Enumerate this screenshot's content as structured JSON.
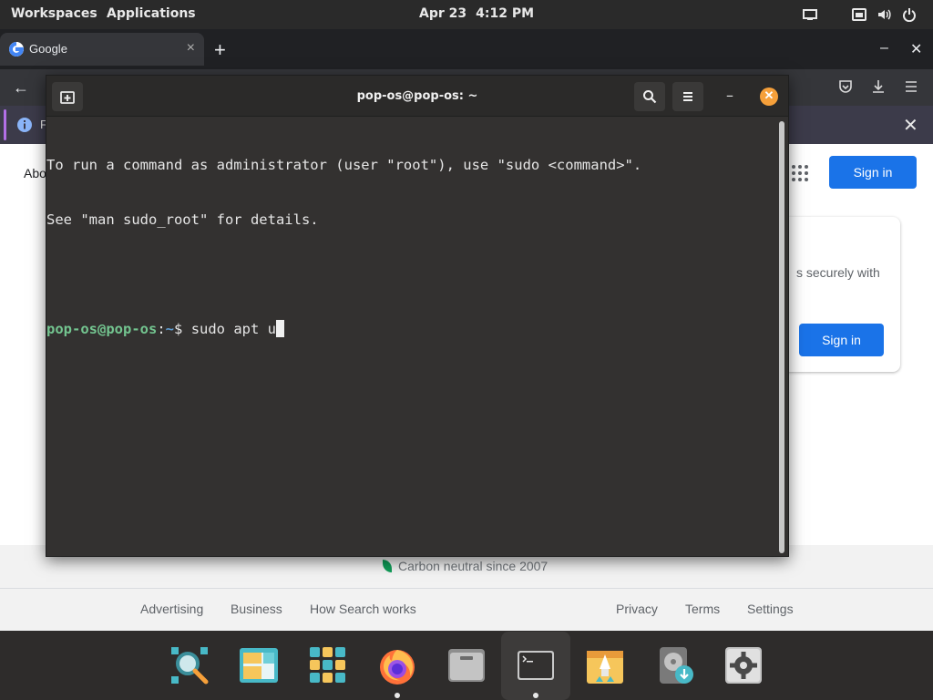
{
  "topbar": {
    "workspaces": "Workspaces",
    "applications": "Applications",
    "date": "Apr 23",
    "time": "4:12 PM"
  },
  "browser": {
    "tab_title": "Google",
    "tab_close": "×",
    "new_tab": "+",
    "minimize": "–",
    "close": "✕",
    "back": "←",
    "infobar_text": "F",
    "infobar_close": "✕",
    "page": {
      "about": "Abo",
      "sign_in": "Sign in",
      "card_text": "s securely with",
      "card_sign_in": "Sign in",
      "carbon": "Carbon neutral since 2007",
      "footer_links_left": [
        "Advertising",
        "Business",
        "How Search works"
      ],
      "footer_links_right": [
        "Privacy",
        "Terms",
        "Settings"
      ]
    }
  },
  "terminal": {
    "title": "pop-os@pop-os: ~",
    "minimize": "–",
    "close": "✕",
    "lines": [
      "To run a command as administrator (user \"root\"), use \"sudo <command>\".",
      "See \"man sudo_root\" for details."
    ],
    "prompt_user": "pop-os@pop-os",
    "prompt_sep": ":",
    "prompt_path": "~",
    "prompt_symbol": "$ ",
    "command": "sudo apt u"
  },
  "dock": {
    "apps": [
      "search-app",
      "workspaces-app",
      "app-library",
      "firefox",
      "files",
      "terminal",
      "pop-shop",
      "disk-installer",
      "settings"
    ]
  },
  "colors": {
    "accent_orange": "#f6a03a",
    "google_blue": "#1a73e8",
    "prompt_green": "#73c48f",
    "prompt_blue": "#5e9cd1"
  }
}
